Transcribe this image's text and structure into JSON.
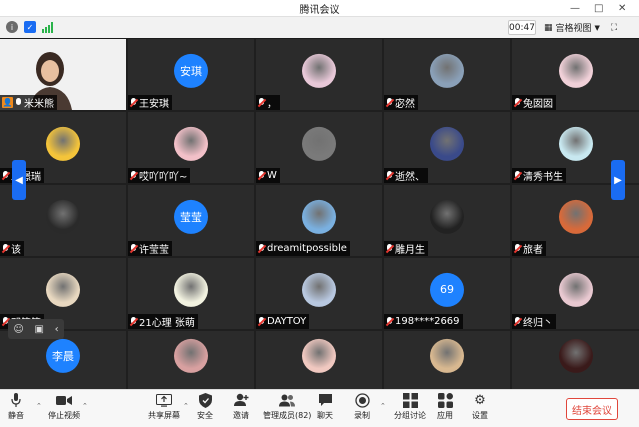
{
  "window": {
    "title": "腾讯会议"
  },
  "infobar": {
    "timer": "00:47",
    "view_label": "宫格视图"
  },
  "participants": [
    {
      "name": "米米熊",
      "avatar": "",
      "color": "#c9a27a",
      "video": true,
      "host": true
    },
    {
      "name": "王安琪",
      "avatar": "安琪",
      "color": "#1e82ff"
    },
    {
      "name": "，",
      "avatar": "",
      "color": "#e8c8d8"
    },
    {
      "name": "宓然",
      "avatar": "",
      "color": "#8aa0b8"
    },
    {
      "name": "兔囡囡",
      "avatar": "",
      "color": "#f0d0d8"
    },
    {
      "name": "邱璟瑞",
      "avatar": "",
      "color": "#f4c43a"
    },
    {
      "name": "哎吖吖吖~",
      "avatar": "",
      "color": "#f2c0c8"
    },
    {
      "name": "W",
      "avatar": "",
      "color": "#7a7a7a"
    },
    {
      "name": "逝然、",
      "avatar": "",
      "color": "#3a4a8a"
    },
    {
      "name": "清秀书生",
      "avatar": "",
      "color": "#c8e8f0"
    },
    {
      "name": "该",
      "avatar": "",
      "color": "#2a2a2a"
    },
    {
      "name": "许莹莹",
      "avatar": "莹莹",
      "color": "#1e82ff"
    },
    {
      "name": "dreamitpossible",
      "avatar": "",
      "color": "#7ab0e0"
    },
    {
      "name": "雕月生",
      "avatar": "",
      "color": "#222222"
    },
    {
      "name": "旅者",
      "avatar": "",
      "color": "#d86a3a"
    },
    {
      "name": "邓策策",
      "avatar": "",
      "color": "#e8d8c0"
    },
    {
      "name": "21心理 张萌",
      "avatar": "",
      "color": "#f2f2e0"
    },
    {
      "name": "DAYTOY",
      "avatar": "",
      "color": "#b8c8e0"
    },
    {
      "name": "198****2669",
      "avatar": "69",
      "color": "#1e82ff"
    },
    {
      "name": "终归丶",
      "avatar": "",
      "color": "#e8c8d0"
    },
    {
      "name": "",
      "avatar": "李晨",
      "color": "#1e82ff"
    },
    {
      "name": "",
      "avatar": "",
      "color": "#d8a0a0"
    },
    {
      "name": "",
      "avatar": "",
      "color": "#f0c8c0"
    },
    {
      "name": "",
      "avatar": "",
      "color": "#d8b890"
    },
    {
      "name": "",
      "avatar": "",
      "color": "#3a1a1a"
    }
  ],
  "toolbar": {
    "mute": "静音",
    "stop_video": "停止视频",
    "share": "共享屏幕",
    "security": "安全",
    "invite": "邀请",
    "members": "管理成员(82)",
    "chat": "聊天",
    "record": "录制",
    "breakout": "分组讨论",
    "apps": "应用",
    "settings": "设置",
    "end": "结束会议"
  }
}
